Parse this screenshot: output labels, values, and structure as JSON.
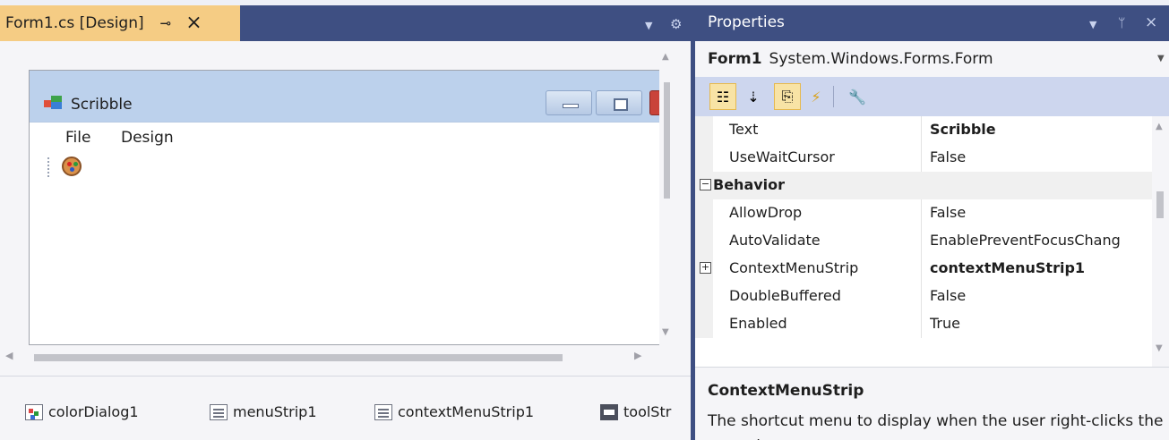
{
  "designer": {
    "tab_label": "Form1.cs [Design]",
    "form": {
      "title": "Scribble",
      "menu": [
        "File",
        "Design"
      ]
    },
    "tray": [
      "colorDialog1",
      "menuStrip1",
      "contextMenuStrip1",
      "toolStr"
    ]
  },
  "properties": {
    "title": "Properties",
    "object_name": "Form1",
    "object_type": "System.Windows.Forms.Form",
    "rows": [
      {
        "name": "Text",
        "value": "Scribble",
        "bold": true
      },
      {
        "name": "UseWaitCursor",
        "value": "False"
      },
      {
        "name": "Behavior",
        "category": true
      },
      {
        "name": "AllowDrop",
        "value": "False"
      },
      {
        "name": "AutoValidate",
        "value": "EnablePreventFocusChang"
      },
      {
        "name": "ContextMenuStrip",
        "value": "contextMenuStrip1",
        "bold": true,
        "expandable": true
      },
      {
        "name": "DoubleBuffered",
        "value": "False"
      },
      {
        "name": "Enabled",
        "value": "True"
      }
    ],
    "description": {
      "title": "ContextMenuStrip",
      "text": "The shortcut menu to display when the user right-clicks the control."
    }
  },
  "colors": {
    "tab_active": "#f5cc84",
    "chrome": "#3e4f82",
    "toolbar": "#cdd6ee"
  }
}
